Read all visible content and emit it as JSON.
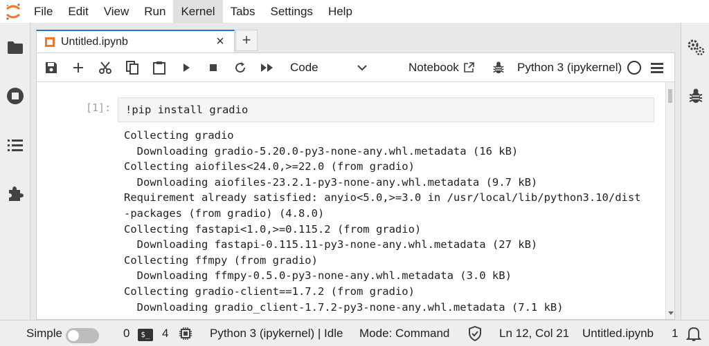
{
  "menubar": {
    "items": [
      "File",
      "Edit",
      "View",
      "Run",
      "Kernel",
      "Tabs",
      "Settings",
      "Help"
    ],
    "active_item": "Kernel"
  },
  "colors": {
    "logo_orange": "#f37726",
    "tab_accent": "#1976d2",
    "menu_active_bg": "#e0e0e0",
    "sidebar_bg": "#eeeeee"
  },
  "left_sidebar": {
    "icons": [
      "folder-icon",
      "running-sessions-icon",
      "table-of-contents-icon",
      "extension-icon"
    ]
  },
  "right_sidebar": {
    "icons": [
      "property-inspector-icon",
      "debugger-icon"
    ]
  },
  "tab": {
    "title": "Untitled.ipynb",
    "close": "×",
    "add": "+"
  },
  "toolbar": {
    "icons": [
      "save-icon",
      "insert-cell-icon",
      "cut-icon",
      "copy-icon",
      "paste-icon",
      "run-icon",
      "stop-icon",
      "restart-icon",
      "restart-run-all-icon"
    ],
    "cell_type": "Code",
    "notebook_label": "Notebook",
    "kernel": "Python 3 (ipykernel)"
  },
  "cell": {
    "prompt": "[1]:",
    "code": "!pip install gradio",
    "output": [
      "Collecting gradio",
      "  Downloading gradio-5.20.0-py3-none-any.whl.metadata (16 kB)",
      "Collecting aiofiles<24.0,>=22.0 (from gradio)",
      "  Downloading aiofiles-23.2.1-py3-none-any.whl.metadata (9.7 kB)",
      "Requirement already satisfied: anyio<5.0,>=3.0 in /usr/local/lib/python3.10/dist",
      "-packages (from gradio) (4.8.0)",
      "Collecting fastapi<1.0,>=0.115.2 (from gradio)",
      "  Downloading fastapi-0.115.11-py3-none-any.whl.metadata (27 kB)",
      "Collecting ffmpy (from gradio)",
      "  Downloading ffmpy-0.5.0-py3-none-any.whl.metadata (3.0 kB)",
      "Collecting gradio-client==1.7.2 (from gradio)",
      "  Downloading gradio_client-1.7.2-py3-none-any.whl.metadata (7.1 kB)"
    ]
  },
  "statusbar": {
    "simple_label": "Simple",
    "terminals_count": "0",
    "kernels_count": "4",
    "kernel_status": "Python 3 (ipykernel) | Idle",
    "mode": "Mode: Command",
    "cursor": "Ln 12, Col 21",
    "filename": "Untitled.ipynb",
    "notifications_count": "1"
  }
}
